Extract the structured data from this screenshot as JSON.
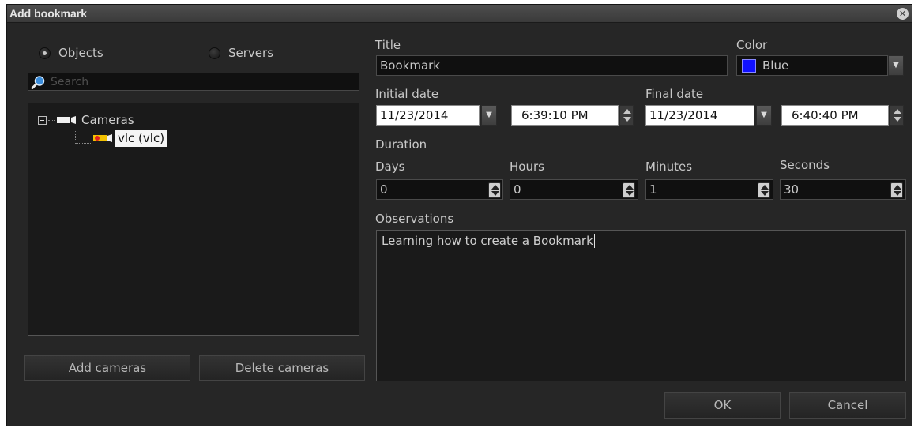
{
  "window": {
    "title": "Add bookmark"
  },
  "left": {
    "radio_objects": "Objects",
    "radio_servers": "Servers",
    "search_placeholder": "Search",
    "tree": {
      "root": "Cameras",
      "child": "vlc (vlc)"
    },
    "add_button": "Add cameras",
    "delete_button": "Delete cameras"
  },
  "form": {
    "title_label": "Title",
    "title_value": "Bookmark",
    "color_label": "Color",
    "color_value": "Blue",
    "color_hex": "#1010ff",
    "initial_date_label": "Initial date",
    "initial_date": "11/23/2014",
    "initial_time": "6:39:10 PM",
    "final_date_label": "Final date",
    "final_date": "11/23/2014",
    "final_time": "6:40:40 PM",
    "duration_label": "Duration",
    "days_label": "Days",
    "days": "0",
    "hours_label": "Hours",
    "hours": "0",
    "minutes_label": "Minutes",
    "minutes": "1",
    "seconds_label": "Seconds",
    "seconds": "30",
    "observations_label": "Observations",
    "observations": "Learning how to create a Bookmark"
  },
  "footer": {
    "ok": "OK",
    "cancel": "Cancel"
  }
}
